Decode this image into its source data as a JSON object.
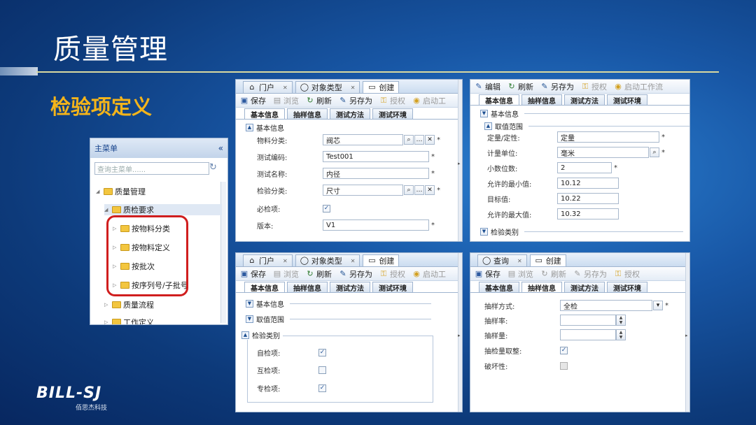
{
  "slide": {
    "title": "质量管理",
    "section": "检验项定义",
    "logo_text": "BILL-SJ",
    "logo_sub": "佰思杰科技"
  },
  "menu": {
    "title": "主菜单",
    "collapse_icon": "«",
    "search_placeholder": "查询主菜单......",
    "items": [
      {
        "label": "质量管理",
        "level": 0
      },
      {
        "label": "质检要求",
        "level": 1
      },
      {
        "label": "按物料分类",
        "level": 2
      },
      {
        "label": "按物料定义",
        "level": 2
      },
      {
        "label": "按批次",
        "level": 2
      },
      {
        "label": "按序列号/子批号",
        "level": 2
      },
      {
        "label": "质量流程",
        "level": 1
      },
      {
        "label": "工作定义",
        "level": 1
      }
    ]
  },
  "panel1": {
    "tabs": [
      "门户",
      "对象类型",
      "创建"
    ],
    "toolbar": [
      "保存",
      "浏览",
      "刷新",
      "另存为",
      "授权",
      "启动工"
    ],
    "subtabs": [
      "基本信息",
      "抽样信息",
      "测试方法",
      "测试环境"
    ],
    "section": "基本信息",
    "fields": [
      {
        "label": "物料分类:",
        "value": "阀芯",
        "required": "*"
      },
      {
        "label": "测试编码:",
        "value": "Test001",
        "required": "*"
      },
      {
        "label": "测试名称:",
        "value": "内径",
        "required": "*"
      },
      {
        "label": "检验分类:",
        "value": "尺寸",
        "required": "*"
      },
      {
        "label": "必检项:",
        "value": "✓",
        "required": ""
      },
      {
        "label": "版本:",
        "value": "V1",
        "required": "*"
      }
    ]
  },
  "panel2": {
    "toolbar": [
      "编辑",
      "刷新",
      "另存为",
      "授权",
      "启动工作流"
    ],
    "subtabs": [
      "基本信息",
      "抽样信息",
      "测试方法",
      "测试环境"
    ],
    "sections": [
      "基本信息",
      "取值范围",
      "检验类别"
    ],
    "fields": [
      {
        "label": "定量/定性:",
        "value": "定量",
        "required": "*"
      },
      {
        "label": "计量单位:",
        "value": "毫米",
        "required": "*"
      },
      {
        "label": "小数位数:",
        "value": "2",
        "required": "*"
      },
      {
        "label": "允许的最小值:",
        "value": "10.12",
        "required": ""
      },
      {
        "label": "目标值:",
        "value": "10.22",
        "required": ""
      },
      {
        "label": "允许的最大值:",
        "value": "10.32",
        "required": ""
      }
    ]
  },
  "panel3": {
    "tabs": [
      "门户",
      "对象类型",
      "创建"
    ],
    "toolbar": [
      "保存",
      "浏览",
      "刷新",
      "另存为",
      "授权",
      "启动工"
    ],
    "subtabs": [
      "基本信息",
      "抽样信息",
      "测试方法",
      "测试环境"
    ],
    "sections": [
      "基本信息",
      "取值范围",
      "检验类别"
    ],
    "checks": [
      {
        "label": "自检项:",
        "checked": "✓"
      },
      {
        "label": "互检项:",
        "checked": ""
      },
      {
        "label": "专检项:",
        "checked": "✓"
      }
    ]
  },
  "panel4": {
    "tabs": [
      "查询",
      "创建"
    ],
    "toolbar": [
      "保存",
      "浏览",
      "刷新",
      "另存为",
      "授权"
    ],
    "subtabs": [
      "基本信息",
      "抽样信息",
      "测试方法",
      "测试环境"
    ],
    "fields": [
      {
        "label": "抽样方式:",
        "value": "全检",
        "required": "*"
      },
      {
        "label": "抽样率:",
        "value": ""
      },
      {
        "label": "抽样量:",
        "value": ""
      },
      {
        "label": "抽检量取整:",
        "value": "✓"
      },
      {
        "label": "破坏性:",
        "value": ""
      }
    ]
  }
}
